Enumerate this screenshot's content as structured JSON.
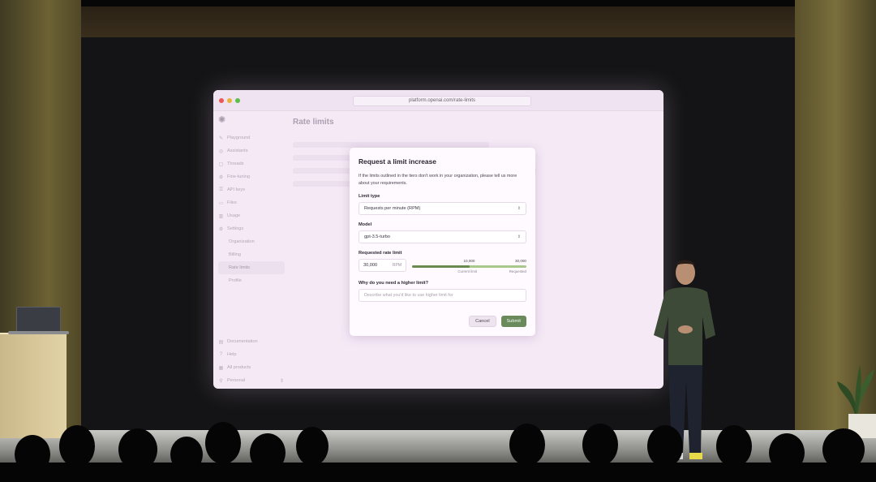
{
  "browser": {
    "url": "platform.openai.com/rate-limits"
  },
  "sidebar": {
    "items": [
      {
        "icon": "playground-icon",
        "label": "Playground"
      },
      {
        "icon": "assistants-icon",
        "label": "Assistants"
      },
      {
        "icon": "threads-icon",
        "label": "Threads"
      },
      {
        "icon": "fine-tuning-icon",
        "label": "Fine-tuning"
      },
      {
        "icon": "api-keys-icon",
        "label": "API keys"
      },
      {
        "icon": "files-icon",
        "label": "Files"
      },
      {
        "icon": "usage-icon",
        "label": "Usage"
      },
      {
        "icon": "settings-icon",
        "label": "Settings"
      }
    ],
    "settings_sub": [
      "Organization",
      "Billing",
      "Rate limits",
      "Profile"
    ],
    "bottom": [
      {
        "icon": "documentation-icon",
        "label": "Documentation"
      },
      {
        "icon": "help-icon",
        "label": "Help"
      },
      {
        "icon": "all-products-icon",
        "label": "All products"
      },
      {
        "icon": "personal-icon",
        "label": "Personal"
      }
    ]
  },
  "page": {
    "title": "Rate limits"
  },
  "modal": {
    "title": "Request a limit increase",
    "description": "If the limits outlined in the tiers don't work in your organization, please tell us more about your requirements.",
    "limit_type_label": "Limit type",
    "limit_type_value": "Requests per minute (RPM)",
    "model_label": "Model",
    "model_value": "gpt-3.5-turbo",
    "rate_label": "Requested rate limit",
    "rate_value": "30,000",
    "rate_unit": "RPM",
    "bar": {
      "current_label": "10,000",
      "requested_label": "30,000",
      "current_caption": "Current limit",
      "requested_caption": "Requested",
      "current_fraction": 0.5
    },
    "reason_label": "Why do you need a higher limit?",
    "reason_placeholder": "Describe what you'd like to use higher limit for",
    "cancel_label": "Cancel",
    "submit_label": "Submit"
  },
  "colors": {
    "accent": "#6a8a5c",
    "screen_bg": "#f5e9f6"
  }
}
